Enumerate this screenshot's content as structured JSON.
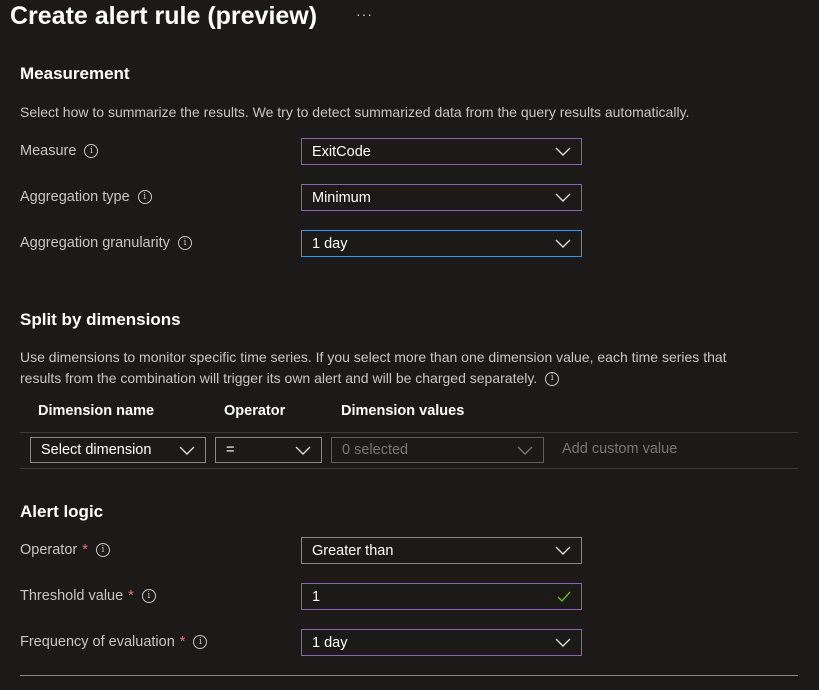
{
  "page": {
    "title": "Create alert rule (preview)",
    "more_label": "···"
  },
  "measurement": {
    "heading": "Measurement",
    "description": "Select how to summarize the results. We try to detect summarized data from the query results automatically.",
    "measure": {
      "label": "Measure",
      "value": "ExitCode"
    },
    "aggregation_type": {
      "label": "Aggregation type",
      "value": "Minimum"
    },
    "aggregation_granularity": {
      "label": "Aggregation granularity",
      "value": "1 day"
    }
  },
  "split": {
    "heading": "Split by dimensions",
    "description_line1": "Use dimensions to monitor specific time series. If you select more than one dimension value, each time series that",
    "description_line2": "results from the combination will trigger its own alert and will be charged separately.",
    "columns": {
      "name": "Dimension name",
      "operator": "Operator",
      "values": "Dimension values"
    },
    "row": {
      "dimension": "Select dimension",
      "operator": "=",
      "values": "0 selected",
      "custom_placeholder": "Add custom value"
    }
  },
  "alert_logic": {
    "heading": "Alert logic",
    "operator": {
      "label": "Operator",
      "value": "Greater than"
    },
    "threshold": {
      "label": "Threshold value",
      "value": "1"
    },
    "frequency": {
      "label": "Frequency of evaluation",
      "value": "1 day"
    },
    "required_marker": "*"
  },
  "icons": {
    "info": "info-icon",
    "chevron": "chevron-down-icon",
    "check": "checkmark-icon",
    "info_glyph": "i"
  },
  "colors": {
    "background": "#1b1a19",
    "accent_border": "#8764b8",
    "focus_border": "#2899f5",
    "required": "#f1707b",
    "valid_check": "#6bb700"
  }
}
